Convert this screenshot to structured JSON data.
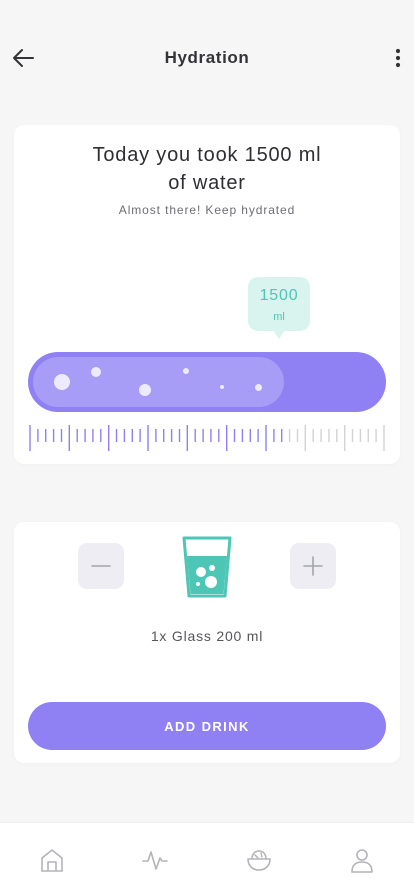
{
  "header": {
    "title": "Hydration",
    "back_icon": "arrow-left-icon",
    "menu_icon": "more-vertical-icon"
  },
  "summary": {
    "headline_line1": "Today you took 1500 ml",
    "headline_line2": "of water",
    "subtitle": "Almost there! Keep hydrated"
  },
  "progress": {
    "value": "1500",
    "unit": "ml",
    "fill_fraction": 0.72
  },
  "drink": {
    "serving_label": "1x Glass 200 ml",
    "minus_icon": "minus-icon",
    "plus_icon": "plus-icon",
    "glass_icon": "water-glass-icon",
    "add_label": "ADD DRINK"
  },
  "tabbar": {
    "items": [
      {
        "icon": "home-icon"
      },
      {
        "icon": "activity-icon"
      },
      {
        "icon": "food-bowl-icon"
      },
      {
        "icon": "profile-icon"
      }
    ]
  },
  "colors": {
    "accent": "#8f80f3",
    "accent_light": "#a79cf6",
    "teal": "#4ec6b6",
    "teal_light": "#d9f4ee",
    "background": "#f6f6f7"
  }
}
